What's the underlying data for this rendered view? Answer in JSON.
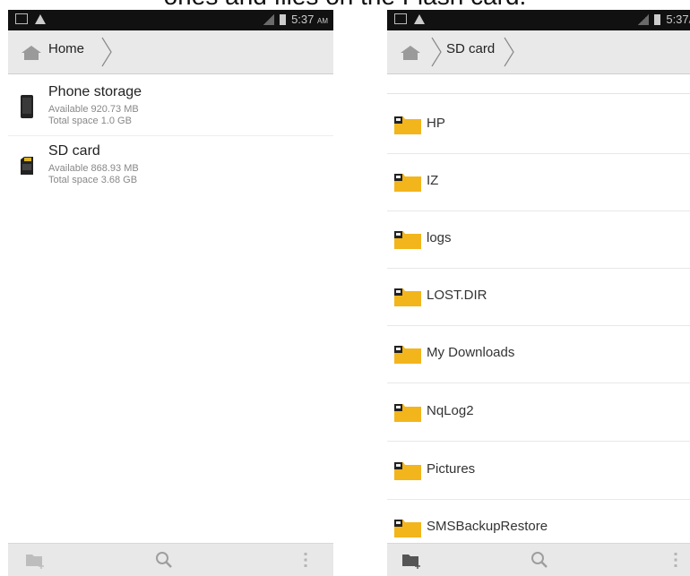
{
  "caption": "ories and files on the Flash card.",
  "left": {
    "status": {
      "time": "5:37",
      "ampm": "AM"
    },
    "breadcrumb": "Home",
    "storage": [
      {
        "title": "Phone storage",
        "available": "Available 920.73 MB",
        "total": "Total space 1.0 GB",
        "icon": "phone-storage-icon"
      },
      {
        "title": "SD card",
        "available": "Available 868.93 MB",
        "total": "Total space 3.68 GB",
        "icon": "sd-card-icon"
      }
    ],
    "bottom_actions": [
      "new-folder-icon",
      "search-icon",
      "overflow-menu-icon"
    ]
  },
  "right": {
    "status": {
      "time": "5:37",
      "ampm": "A"
    },
    "breadcrumb": "SD card",
    "folders": [
      "HP",
      "IZ",
      "logs",
      "LOST.DIR",
      "My Downloads",
      "NqLog2",
      "Pictures",
      "SMSBackupRestore"
    ],
    "bottom_actions": [
      "new-folder-icon",
      "search-icon",
      "overflow-menu-icon"
    ]
  },
  "colors": {
    "statusbar": "#111111",
    "crumbbar": "#e9e9e9",
    "folder": "#f3b51c",
    "bottombar": "#e8e8e8"
  }
}
